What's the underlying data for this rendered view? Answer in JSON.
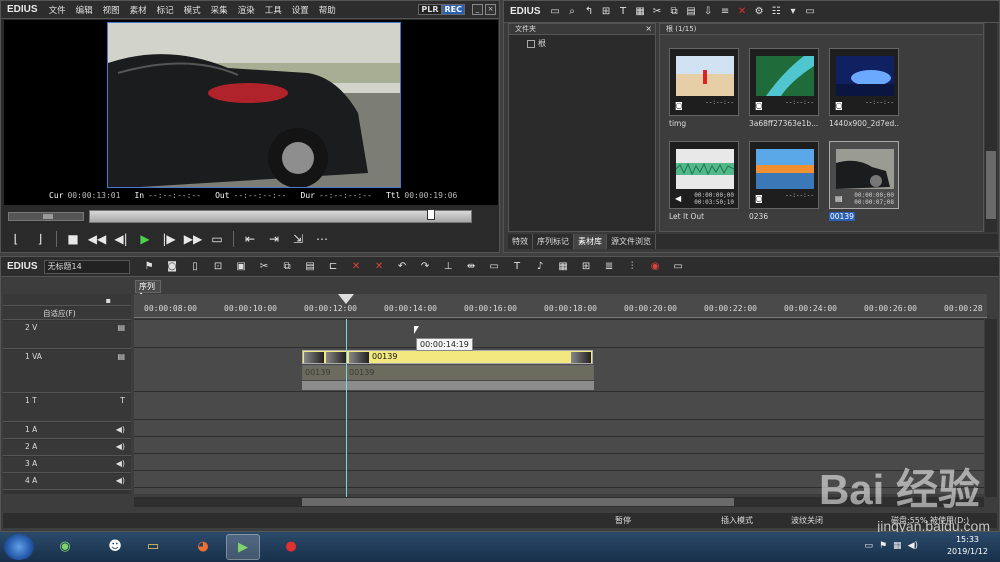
{
  "player": {
    "logo": "EDIUS",
    "menu": [
      "文件",
      "编辑",
      "视图",
      "素材",
      "标记",
      "模式",
      "采集",
      "渲染",
      "工具",
      "设置",
      "帮助"
    ],
    "plr": "PLR",
    "rec": "REC",
    "timecodes": {
      "cur_label": "Cur",
      "cur": "00:00:13:01",
      "in_label": "In",
      "in": "--:--:--:--",
      "out_label": "Out",
      "out": "--:--:--:--",
      "dur_label": "Dur",
      "dur": "--:--:--:--",
      "ttl_label": "Ttl",
      "ttl": "00:00:19:06"
    }
  },
  "bin": {
    "logo": "EDIUS",
    "folder_header": "文件夹",
    "root_label": "根",
    "clips_header": "根 (1/15)",
    "clips": [
      {
        "name": "timg",
        "duration": "--:--:--",
        "type": "image"
      },
      {
        "name": "3a68ff27363e1b...",
        "duration": "--:--:--",
        "type": "image"
      },
      {
        "name": "1440x900_2d7ed...",
        "duration": "--:--:--",
        "type": "image"
      },
      {
        "name": "Let It Out",
        "duration_top": "00:00:00;00",
        "duration": "00:03:50;10",
        "type": "audio"
      },
      {
        "name": "0236",
        "duration": "--:--:--",
        "type": "image"
      },
      {
        "name": "00139",
        "duration_top": "00:00:00;00",
        "duration": "00:00:07;08",
        "type": "video",
        "selected": true
      }
    ],
    "tabs": [
      "特效",
      "序列标记",
      "素材库",
      "源文件浏览"
    ],
    "active_tab": 2
  },
  "timeline": {
    "logo": "EDIUS",
    "project_name": "无标题14",
    "sequence_tab": "序列1",
    "ruler_labels": [
      "00:00:08:00",
      "00:00:10:00",
      "00:00:12:00",
      "00:00:14:00",
      "00:00:16:00",
      "00:00:18:00",
      "00:00:20:00",
      "00:00:22:00",
      "00:00:24:00",
      "00:00:26:00",
      "00:00:28"
    ],
    "mode_select": "自适应(F)",
    "tracks": [
      {
        "label": "2 V"
      },
      {
        "label": "1 VA"
      },
      {
        "label": "1 T",
        "icon": "T"
      },
      {
        "label": "1 A"
      },
      {
        "label": "2 A"
      },
      {
        "label": "3 A"
      },
      {
        "label": "4 A"
      }
    ],
    "clip_video_label": "00139",
    "clip_audio_label_1": "00139",
    "clip_audio_label_2": "00139",
    "tooltip": "00:00:14:19",
    "status": {
      "pause": "暂停",
      "insert_mode": "插入模式",
      "ripple": "波纹关闭",
      "disk": "磁盘:55% 被使用(D:)"
    }
  },
  "taskbar": {
    "time": "15:33",
    "date": "2019/1/12"
  },
  "watermark": {
    "text": "Bai 经验",
    "url": "jingyan.baidu.com"
  }
}
